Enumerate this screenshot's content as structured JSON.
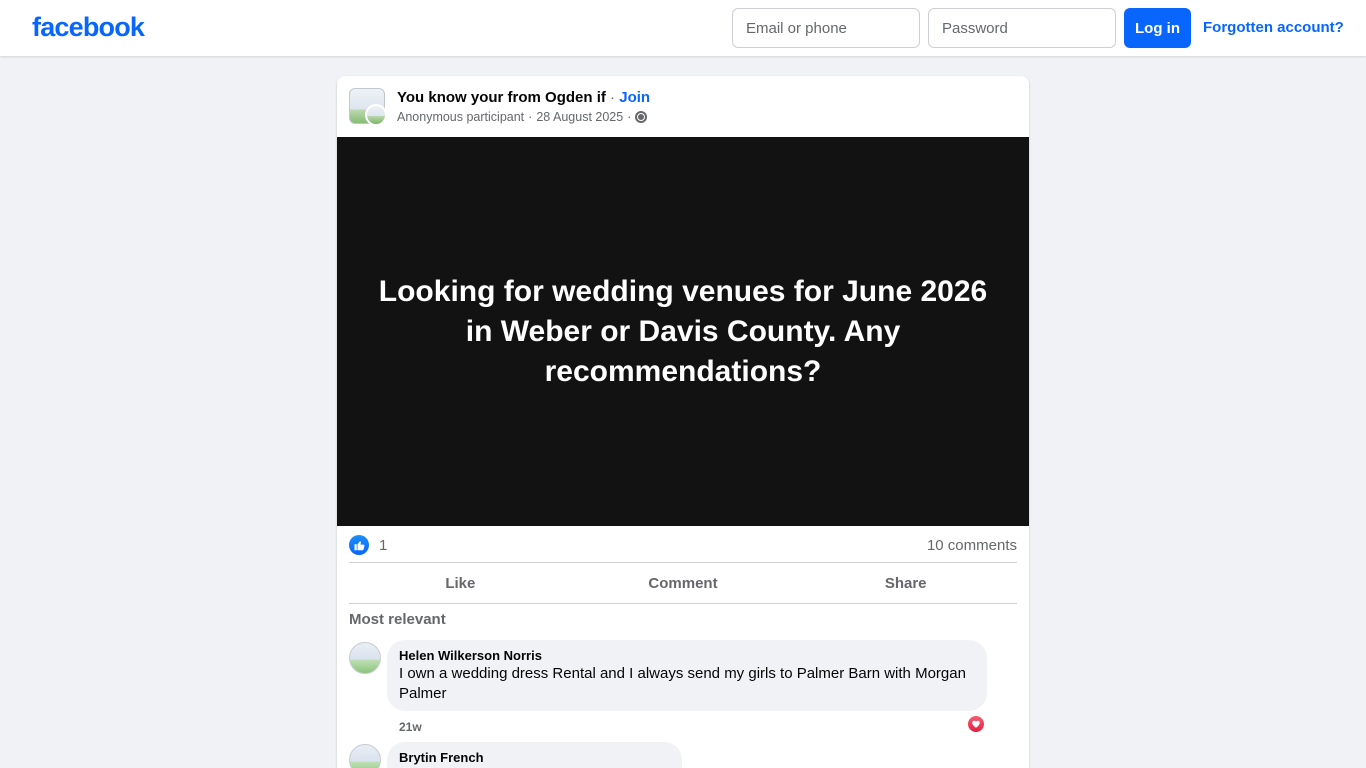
{
  "header": {
    "logo": "facebook",
    "email_placeholder": "Email or phone",
    "password_placeholder": "Password",
    "login_label": "Log in",
    "forgot_label": "Forgotten account?"
  },
  "post": {
    "group_name": "You know your from Ogden if",
    "separator": " · ",
    "join_label": "Join",
    "author": "Anonymous participant",
    "date": "28 August 2025",
    "meta_separator": "·",
    "body": "Looking for wedding venues for June 2026 in Weber or Davis County. Any recommendations?",
    "background_color": "#121212",
    "reaction_count": "1",
    "comment_count": "10 comments",
    "actions": {
      "like": "Like",
      "comment": "Comment",
      "share": "Share"
    },
    "sort_label": "Most relevant"
  },
  "comments": [
    {
      "author": "Helen Wilkerson Norris",
      "text": "I own a wedding dress Rental and I always send my girls to Palmer Barn with Morgan Palmer",
      "time": "21w",
      "reaction": "heart-icon"
    },
    {
      "author": "Brytin French",
      "text": "",
      "time": ""
    }
  ],
  "colors": {
    "brand": "#0866ff",
    "page_bg": "#f0f2f5",
    "muted_text": "#65676b",
    "love": "#e41e3f"
  }
}
